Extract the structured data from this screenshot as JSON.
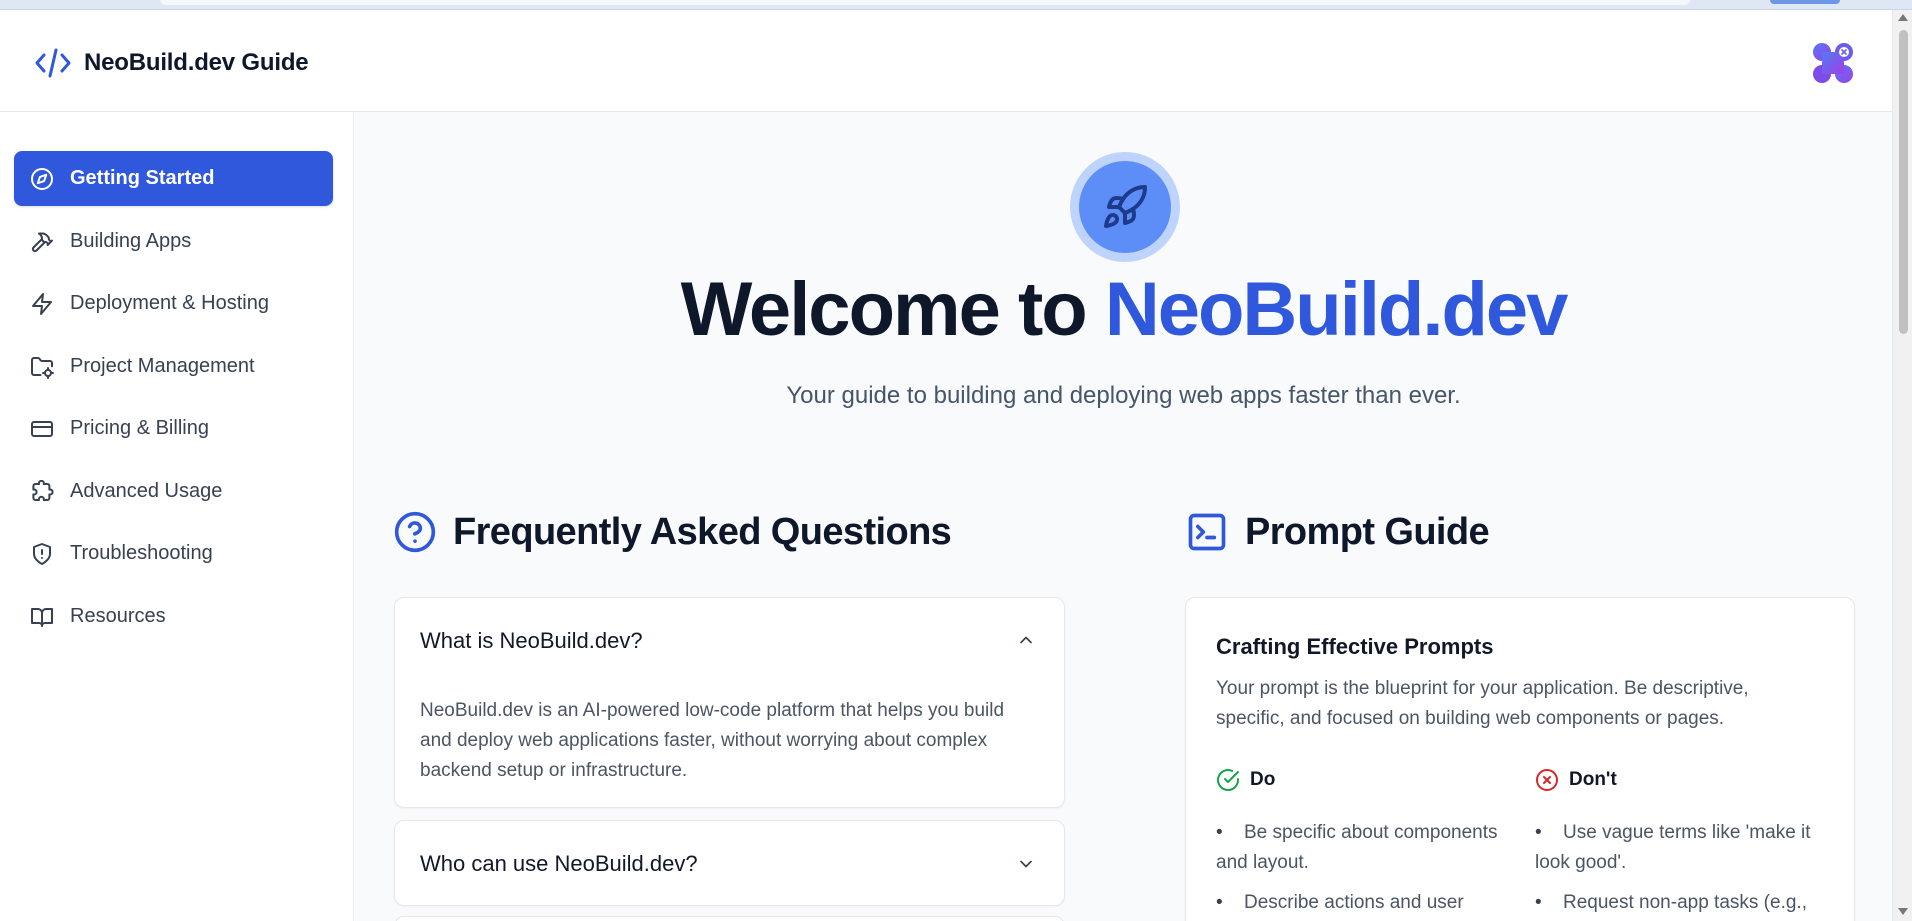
{
  "header": {
    "title": "NeoBuild.dev Guide",
    "logo_icon": "code-brackets-icon",
    "app_icon": "app-grid-logo-icon"
  },
  "sidebar": {
    "items": [
      {
        "label": "Getting Started",
        "icon": "compass-icon",
        "active": true
      },
      {
        "label": "Building Apps",
        "icon": "hammer-icon"
      },
      {
        "label": "Deployment & Hosting",
        "icon": "lightning-icon"
      },
      {
        "label": "Project Management",
        "icon": "folder-cog-icon"
      },
      {
        "label": "Pricing & Billing",
        "icon": "credit-card-icon"
      },
      {
        "label": "Advanced Usage",
        "icon": "puzzle-icon"
      },
      {
        "label": "Troubleshooting",
        "icon": "shield-icon"
      },
      {
        "label": "Resources",
        "icon": "book-icon"
      }
    ]
  },
  "hero": {
    "title_prefix": "Welcome to ",
    "title_brand": "NeoBuild.dev",
    "subtitle": "Your guide to building and deploying web apps faster than ever.",
    "icon": "rocket-icon"
  },
  "faq": {
    "title": "Frequently Asked Questions",
    "icon": "question-circle-icon",
    "items": [
      {
        "question": "What is NeoBuild.dev?",
        "answer": "NeoBuild.dev is an AI-powered low-code platform that helps you build and deploy web applications faster, without worrying about complex backend setup or infrastructure.",
        "expanded": true
      },
      {
        "question": "Who can use NeoBuild.dev?",
        "expanded": false
      }
    ]
  },
  "prompt_guide": {
    "title": "Prompt Guide",
    "icon": "terminal-icon",
    "card_title": "Crafting Effective Prompts",
    "card_desc": "Your prompt is the blueprint for your application. Be descriptive, specific, and focused on building web components or pages.",
    "do": {
      "label": "Do",
      "items": [
        "Be specific about components and layout.",
        "Describe actions and user flows."
      ]
    },
    "dont": {
      "label": "Don't",
      "items": [
        "Use vague terms like 'make it look good'.",
        "Request non-app tasks (e.g., writing text)."
      ]
    }
  },
  "colors": {
    "accent": "#2f58dd",
    "do_green": "#16a34a",
    "dont_red": "#dc2626"
  }
}
